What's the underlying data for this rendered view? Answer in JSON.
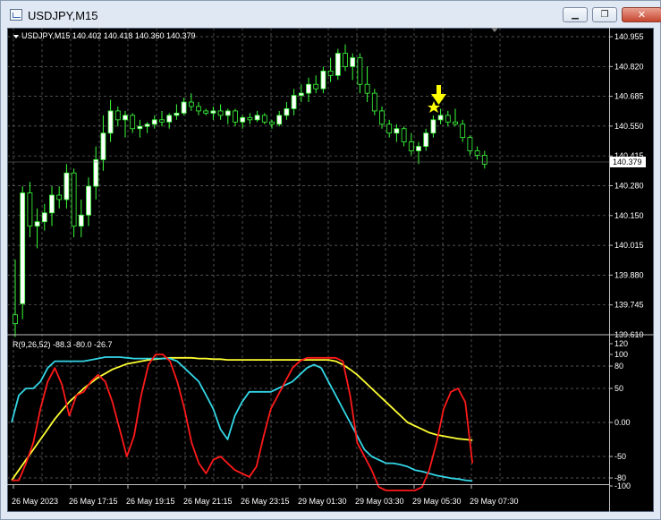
{
  "window": {
    "title": "USDJPY,M15",
    "minimize_label": "▁",
    "maximize_label": "❐",
    "close_label": "✕"
  },
  "chart": {
    "header": "USDJPY,M15  140.402 140.418 140.360 140.379",
    "current_price": "140.379",
    "price_axis_labels": [
      "140.955",
      "140.820",
      "140.685",
      "140.550",
      "140.415",
      "140.280",
      "140.150",
      "140.015",
      "139.880",
      "139.745",
      "139.610"
    ],
    "time_axis_labels": [
      "26 May 2023",
      "26 May 17:15",
      "26 May 19:15",
      "26 May 21:15",
      "26 May 23:15",
      "29 May 01:30",
      "29 May 03:30",
      "29 May 05:30",
      "29 May 07:30"
    ],
    "colors": {
      "background": "#000000",
      "grid": "#808080",
      "bull_candle": "#ffffff",
      "bear_candle": "#000000",
      "wick": "#3aff3a",
      "marker": "#ffff00"
    }
  },
  "indicator": {
    "header": "R(9,26,52) -88.3 -80.0 -26.7",
    "axis_labels": [
      "120",
      "100",
      "80",
      "50",
      "0.00",
      "-50",
      "-80",
      "-100"
    ],
    "colors": {
      "fast": "#ff1a1a",
      "mid": "#33d6e6",
      "slow": "#ffff33"
    }
  }
}
